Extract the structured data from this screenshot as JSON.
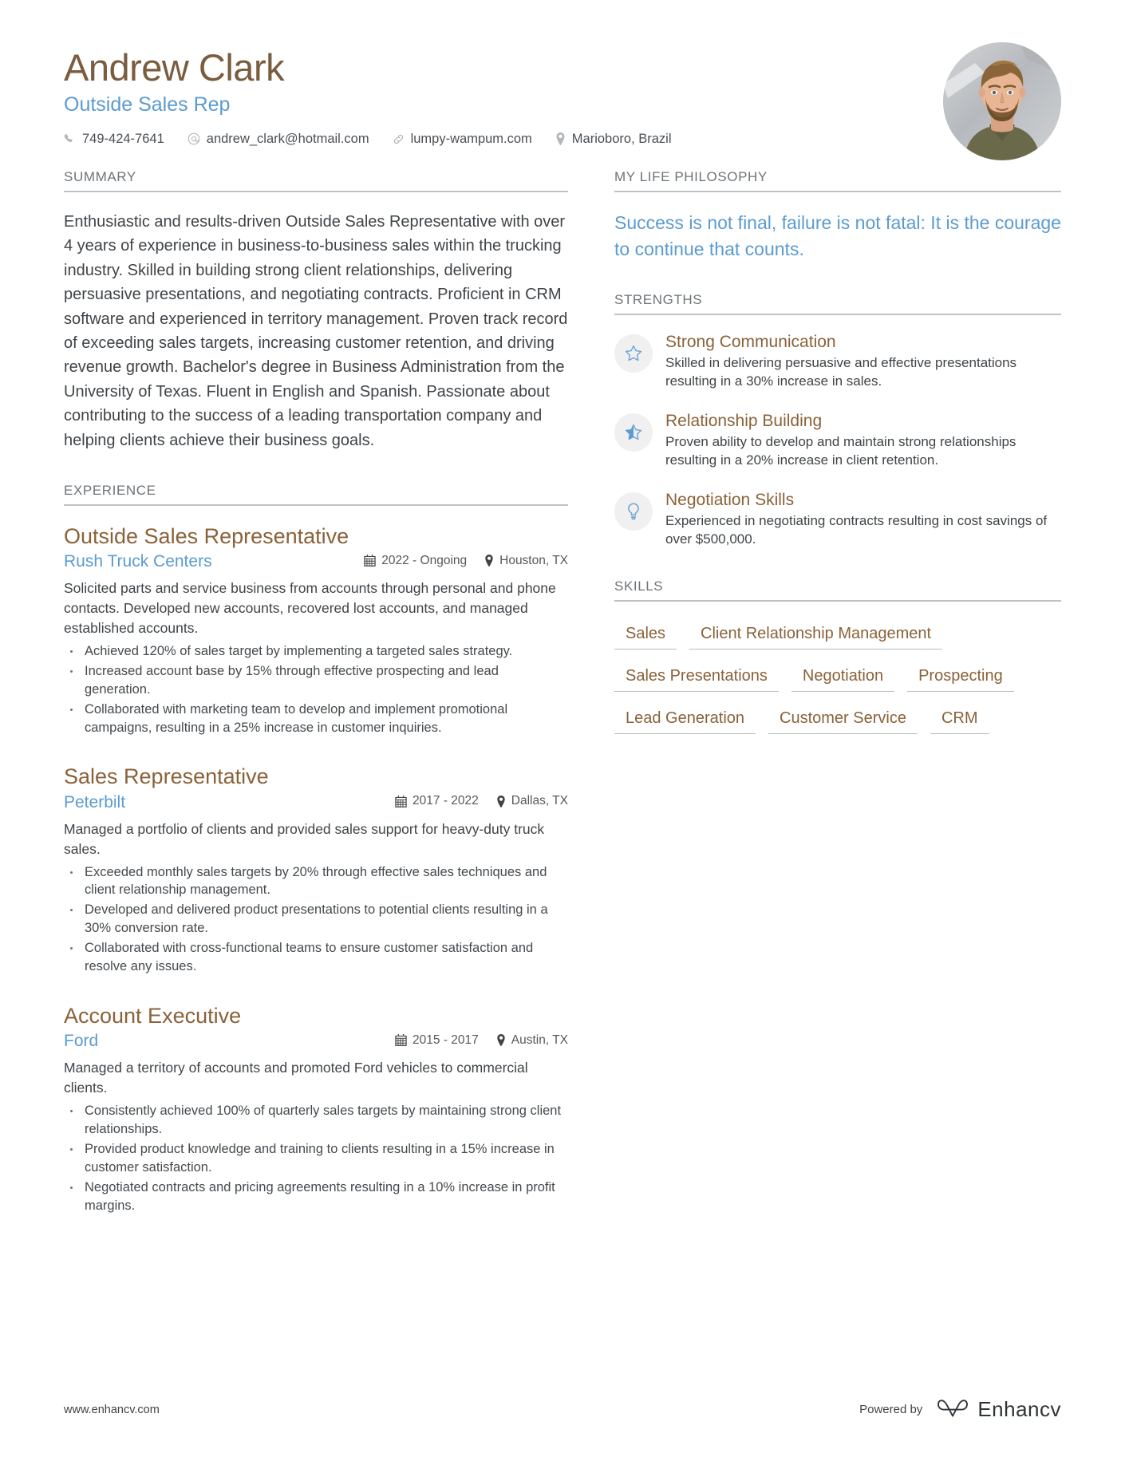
{
  "header": {
    "name": "Andrew Clark",
    "job_title": "Outside Sales Rep",
    "contacts": [
      {
        "icon": "phone-icon",
        "value": "749-424-7641"
      },
      {
        "icon": "email-icon",
        "value": "andrew_clark@hotmail.com"
      },
      {
        "icon": "link-icon",
        "value": "lumpy-wampum.com"
      },
      {
        "icon": "location-pin-icon",
        "value": "Marioboro, Brazil"
      }
    ]
  },
  "sections": {
    "summary": {
      "title": "SUMMARY",
      "text": "Enthusiastic and results-driven Outside Sales Representative with over 4 years of experience in business-to-business sales within the trucking industry. Skilled in building strong client relationships, delivering persuasive presentations, and negotiating contracts. Proficient in CRM software and experienced in territory management. Proven track record of exceeding sales targets, increasing customer retention, and driving revenue growth. Bachelor's degree in Business Administration from the University of Texas. Fluent in English and Spanish. Passionate about contributing to the success of a leading transportation company and helping clients achieve their business goals."
    },
    "experience": {
      "title": "EXPERIENCE",
      "entries": [
        {
          "role": "Outside Sales Representative",
          "company": "Rush Truck Centers",
          "date": "2022 - Ongoing",
          "location": "Houston, TX",
          "description": "Solicited parts and service business from accounts through personal and phone contacts. Developed new accounts, recovered lost accounts, and managed established accounts.",
          "bullets": [
            "Achieved 120% of sales target by implementing a targeted sales strategy.",
            "Increased account base by 15% through effective prospecting and lead generation.",
            "Collaborated with marketing team to develop and implement promotional campaigns, resulting in a 25% increase in customer inquiries."
          ]
        },
        {
          "role": "Sales Representative",
          "company": "Peterbilt",
          "date": "2017 - 2022",
          "location": "Dallas, TX",
          "description": "Managed a portfolio of clients and provided sales support for heavy-duty truck sales.",
          "bullets": [
            "Exceeded monthly sales targets by 20% through effective sales techniques and client relationship management.",
            "Developed and delivered product presentations to potential clients resulting in a 30% conversion rate.",
            "Collaborated with cross-functional teams to ensure customer satisfaction and resolve any issues."
          ]
        },
        {
          "role": "Account Executive",
          "company": "Ford",
          "date": "2015 - 2017",
          "location": "Austin, TX",
          "description": "Managed a territory of accounts and promoted Ford vehicles to commercial clients.",
          "bullets": [
            "Consistently achieved 100% of quarterly sales targets by maintaining strong client relationships.",
            "Provided product knowledge and training to clients resulting in a 15% increase in customer satisfaction.",
            "Negotiated contracts and pricing agreements resulting in a 10% increase in profit margins."
          ]
        }
      ]
    },
    "philosophy": {
      "title": "MY LIFE PHILOSOPHY",
      "quote": "Success is not final, failure is not fatal: It is the courage to continue that counts."
    },
    "strengths": {
      "title": "STRENGTHS",
      "items": [
        {
          "icon": "star-outline-icon",
          "title": "Strong Communication",
          "description": "Skilled in delivering persuasive and effective presentations resulting in a 30% increase in sales."
        },
        {
          "icon": "star-half-filled-icon",
          "title": "Relationship Building",
          "description": "Proven ability to develop and maintain strong relationships resulting in a 20% increase in client retention."
        },
        {
          "icon": "lightbulb-icon",
          "title": "Negotiation Skills",
          "description": "Experienced in negotiating contracts resulting in cost savings of over $500,000."
        }
      ]
    },
    "skills": {
      "title": "SKILLS",
      "items": [
        "Sales",
        "Client Relationship Management",
        "Sales Presentations",
        "Negotiation",
        "Prospecting",
        "Lead Generation",
        "Customer Service",
        "CRM"
      ]
    }
  },
  "footer": {
    "url": "www.enhancv.com",
    "powered_by": "Powered by",
    "brand": "Enhancv"
  },
  "colors": {
    "brown": "#8a6239",
    "name_brown": "#7a5c3e",
    "blue": "#5b9bd0",
    "text": "#3f4448",
    "rule": "#bdc2c6"
  }
}
